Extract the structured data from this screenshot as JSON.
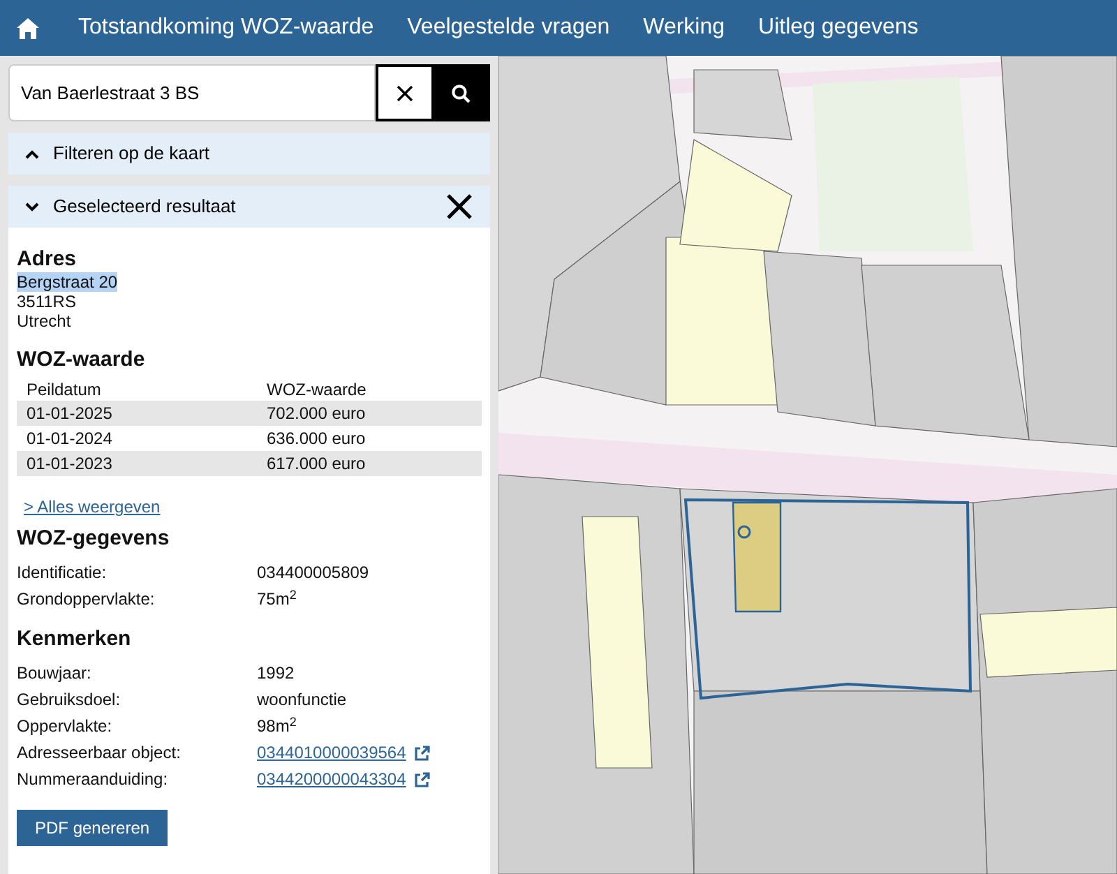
{
  "nav": {
    "items": [
      "Totstandkoming WOZ-waarde",
      "Veelgestelde vragen",
      "Werking",
      "Uitleg gegevens"
    ]
  },
  "search": {
    "value": "Van Baerlestraat 3 BS"
  },
  "panels": [
    {
      "title": "Filteren op de kaart",
      "expanded": false
    },
    {
      "title": "Geselecteerd resultaat",
      "expanded": true
    }
  ],
  "address": {
    "heading": "Adres",
    "lines": [
      {
        "text": "Bergstraat 20",
        "highlighted": true
      },
      {
        "text": "3511RS",
        "highlighted": false
      },
      {
        "text": "Utrecht",
        "highlighted": false
      }
    ]
  },
  "woz_values": {
    "heading": "WOZ-waarde",
    "columns": [
      "Peildatum",
      "WOZ-waarde"
    ],
    "rows": [
      [
        "01-01-2025",
        "702.000 euro"
      ],
      [
        "01-01-2024",
        "636.000 euro"
      ],
      [
        "01-01-2023",
        "617.000 euro"
      ]
    ],
    "show_all_link": "> Alles weergeven"
  },
  "sections": [
    {
      "heading": "WOZ-gegevens",
      "rows": [
        {
          "label": "Identificatie:",
          "value": "034400005809",
          "kind": "text"
        },
        {
          "label": "Grondoppervlakte:",
          "value": "75m$^{2}$",
          "kind": "text"
        }
      ]
    },
    {
      "heading": "Kenmerken",
      "rows": [
        {
          "label": "Bouwjaar:",
          "value": "1992",
          "kind": "text"
        },
        {
          "label": "Gebruiksdoel:",
          "value": "woonfunctie",
          "kind": "text"
        },
        {
          "label": "Oppervlakte:",
          "value": "98m$^{2}$",
          "kind": "text"
        },
        {
          "label": "Adresseerbaar object:",
          "value": "0344010000039564",
          "kind": "link"
        },
        {
          "label": "Nummeraanduiding:",
          "value": "0344200000043304",
          "kind": "link"
        }
      ]
    }
  ],
  "pdf_button": "PDF genereren"
}
